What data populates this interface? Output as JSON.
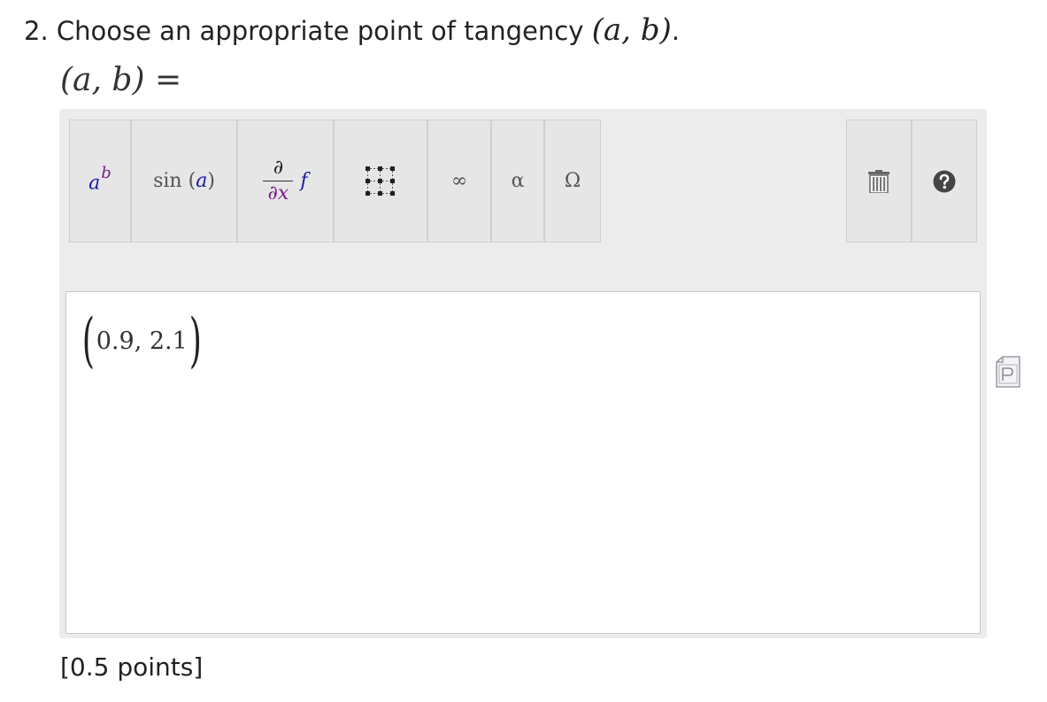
{
  "question": {
    "number": "2.",
    "text": "Choose an appropriate point of tangency",
    "math": "(a, b)",
    "end": "."
  },
  "answer_label": {
    "math": "(a, b)",
    "equals": "="
  },
  "toolbar": {
    "power": {
      "base": "a",
      "exponent": "b"
    },
    "sin": {
      "fn": "sin",
      "open": "(",
      "arg": "a",
      "close": ")"
    },
    "derivative": {
      "num": "∂",
      "den": "∂x",
      "fn": "f"
    },
    "infinity": "∞",
    "alpha": "α",
    "omega": "Ω"
  },
  "input": {
    "value": "0.9, 2.1",
    "open": "(",
    "close": ")"
  },
  "points": "[0.5 points]"
}
